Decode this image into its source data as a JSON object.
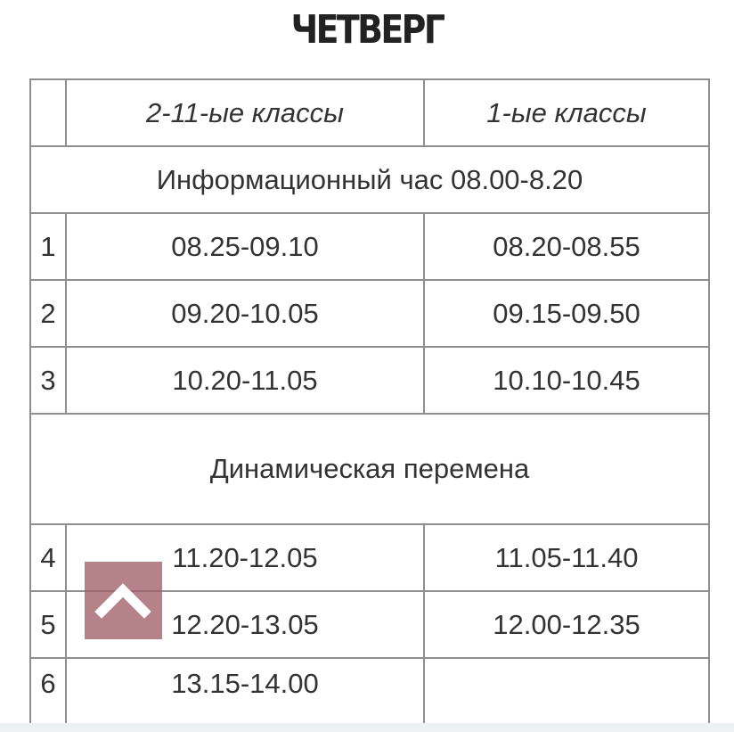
{
  "page": {
    "title": "ЧЕТВЕРГ"
  },
  "schedule": {
    "headers": {
      "num": "",
      "col_a": "2-11-ые классы",
      "col_b": "1-ые классы"
    },
    "info_hour": "Информационный час 08.00-8.20",
    "lessons_before_break": [
      {
        "num": "1",
        "col_a": "08.25-09.10",
        "col_b": "08.20-08.55"
      },
      {
        "num": "2",
        "col_a": "09.20-10.05",
        "col_b": "09.15-09.50"
      },
      {
        "num": "3",
        "col_a": "10.20-11.05",
        "col_b": "10.10-10.45"
      }
    ],
    "dynamic_break": "Динамическая перемена",
    "lessons_after_break": [
      {
        "num": "4",
        "col_a": "11.20-12.05",
        "col_b": "11.05-11.40"
      },
      {
        "num": "5",
        "col_a": "12.20-13.05",
        "col_b": "12.00-12.35"
      },
      {
        "num": "6",
        "col_a": "13.15-14.00",
        "col_b": ""
      }
    ]
  },
  "scroll_top_button": {
    "icon": "chevron-up-icon",
    "color": "#a05f69"
  }
}
